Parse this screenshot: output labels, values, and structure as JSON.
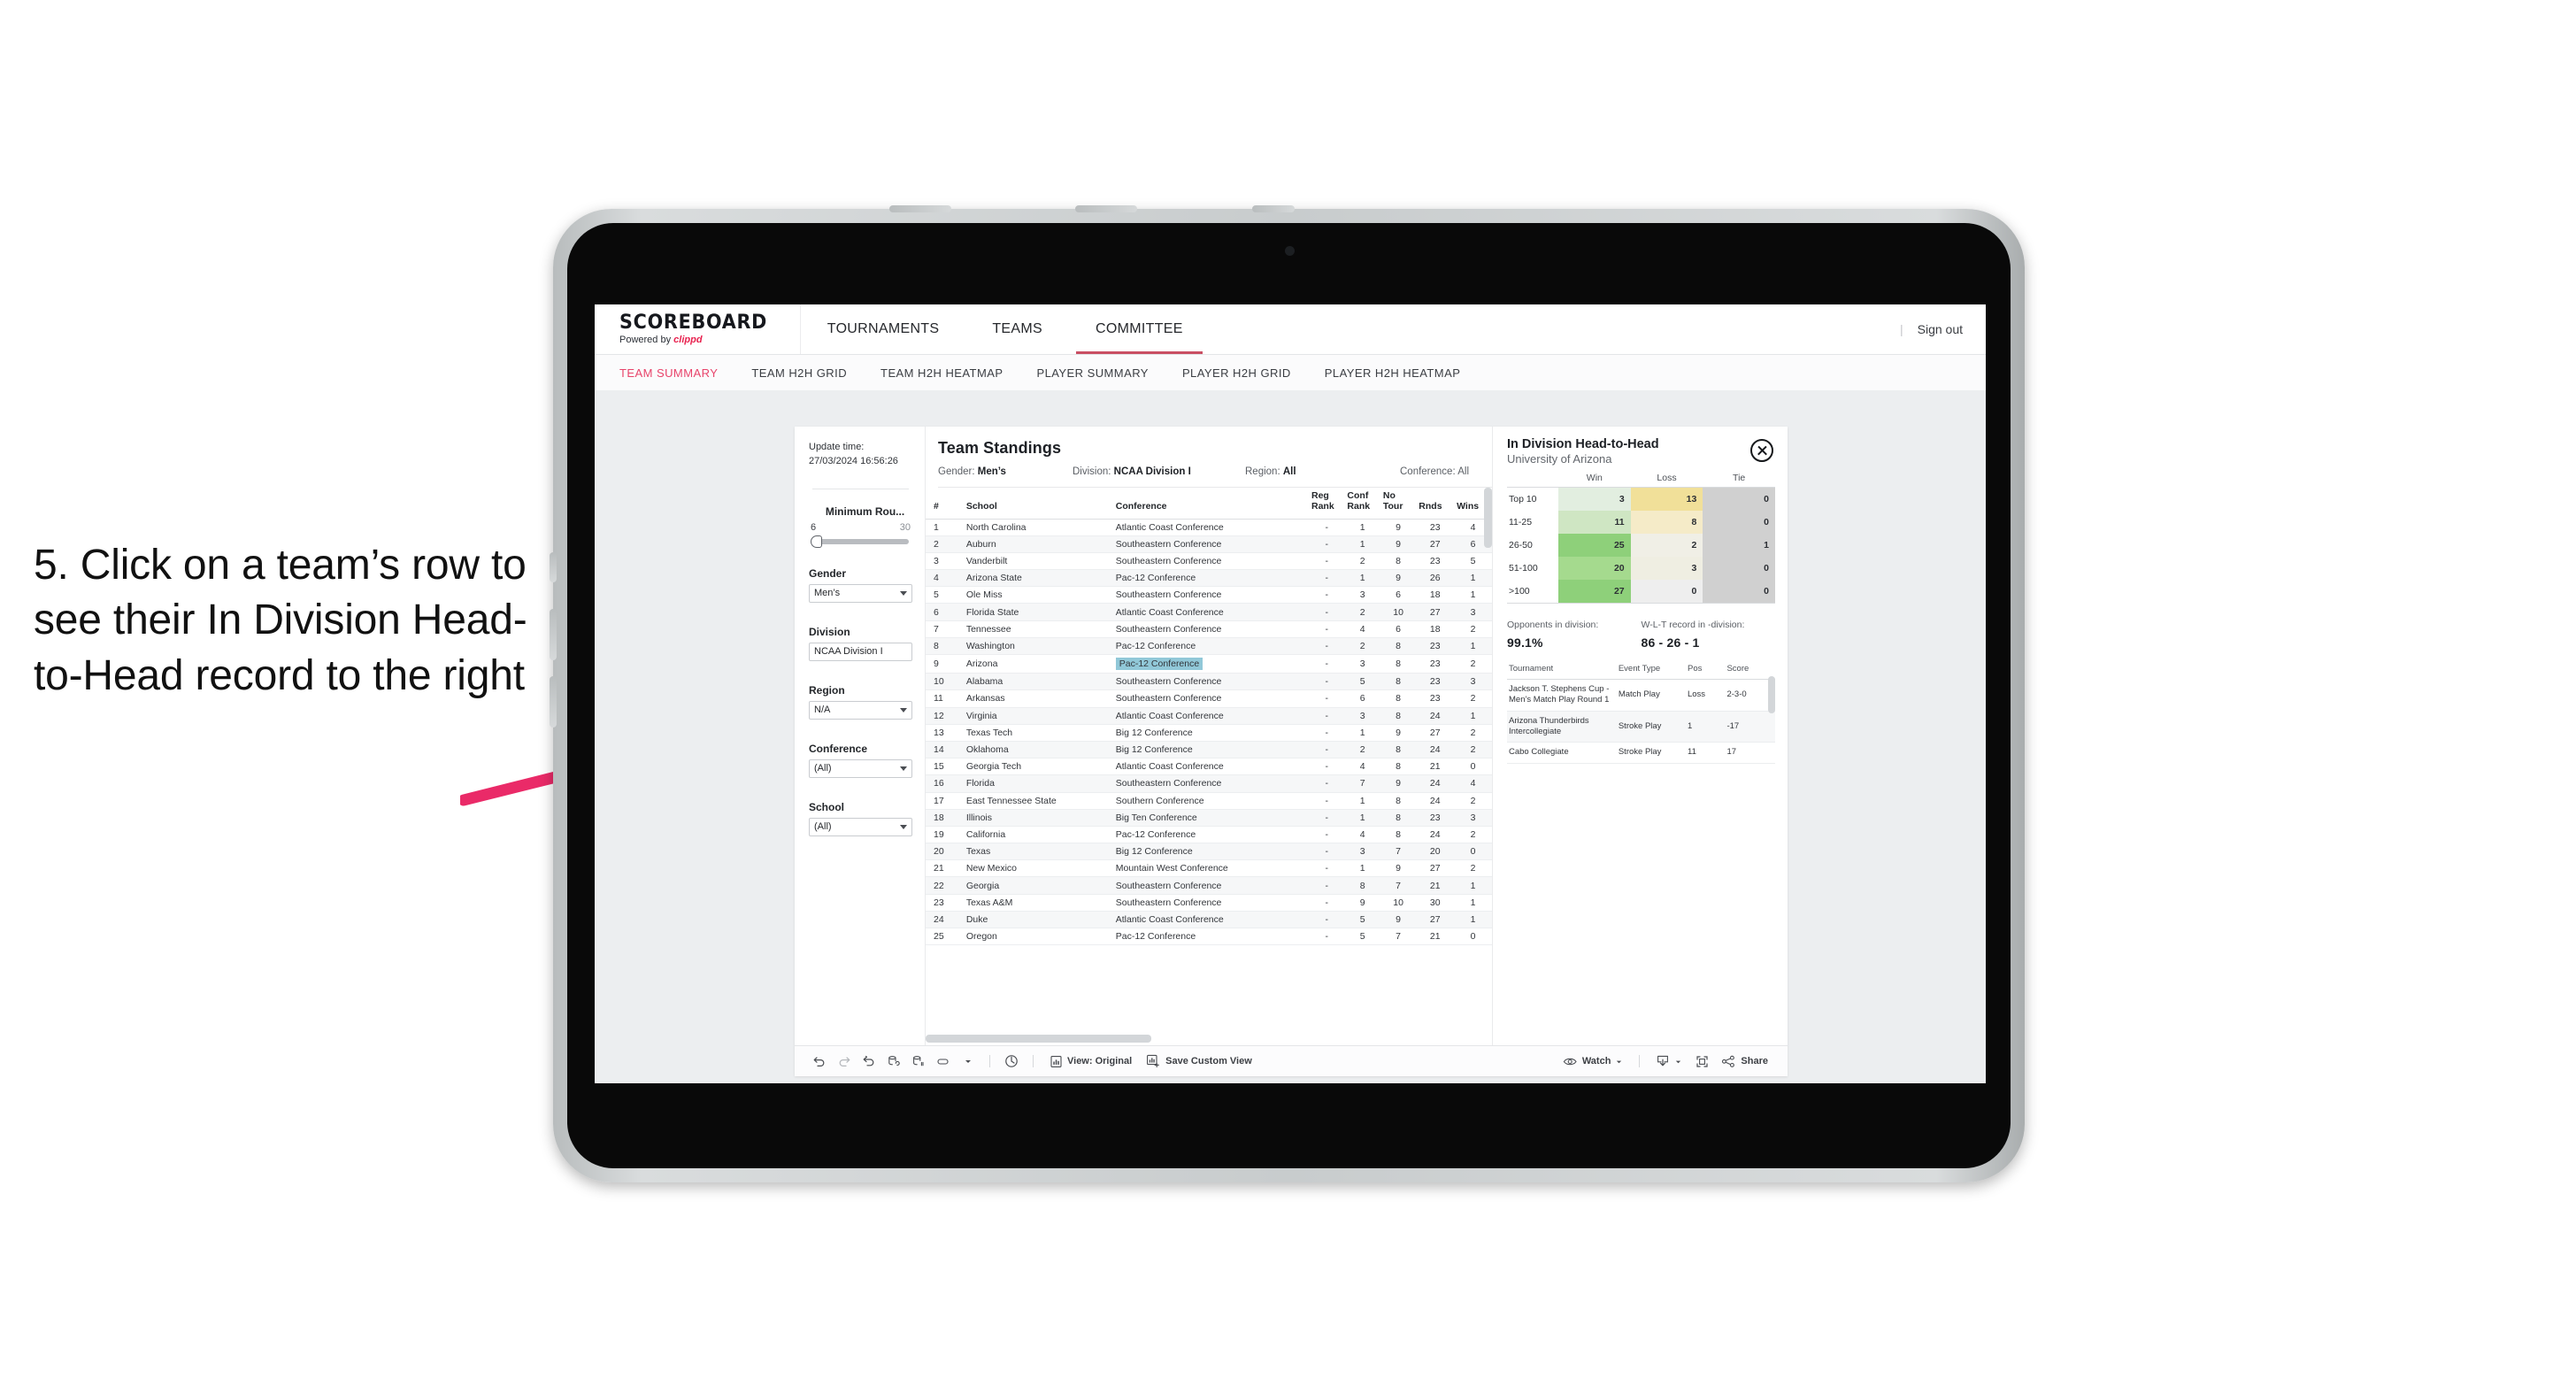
{
  "annotation": {
    "text": "5. Click on a team’s row to see their In Division Head-to-Head record to the right",
    "arrow_color": "#ea2a68"
  },
  "app": {
    "brand": {
      "name": "SCOREBOARD",
      "powered_prefix": "Powered by ",
      "powered_brand": "clippd"
    },
    "topnav": [
      {
        "label": "TOURNAMENTS",
        "active": false
      },
      {
        "label": "TEAMS",
        "active": false
      },
      {
        "label": "COMMITTEE",
        "active": true
      }
    ],
    "topbar_right": {
      "divider": "|",
      "sign_out": "Sign out"
    },
    "subnav": [
      {
        "label": "TEAM SUMMARY",
        "active": true
      },
      {
        "label": "TEAM H2H GRID",
        "active": false
      },
      {
        "label": "TEAM H2H HEATMAP",
        "active": false
      },
      {
        "label": "PLAYER SUMMARY",
        "active": false
      },
      {
        "label": "PLAYER H2H GRID",
        "active": false
      },
      {
        "label": "PLAYER H2H HEATMAP",
        "active": false
      }
    ]
  },
  "filters": {
    "update_label": "Update time:",
    "update_value": "27/03/2024 16:56:26",
    "min_rounds": {
      "title": "Minimum Rou...",
      "min": "6",
      "max": "30"
    },
    "gender": {
      "title": "Gender",
      "value": "Men’s"
    },
    "division": {
      "title": "Division",
      "value": "NCAA Division I"
    },
    "region": {
      "title": "Region",
      "value": "N/A"
    },
    "conference": {
      "title": "Conference",
      "value": "(All)"
    },
    "school": {
      "title": "School",
      "value": "(All)"
    }
  },
  "standings": {
    "title": "Team Standings",
    "meta": [
      {
        "label": "Gender: ",
        "value": "Men’s"
      },
      {
        "label": "Division: ",
        "value": "NCAA Division I"
      },
      {
        "label": "Region: ",
        "value": "All"
      },
      {
        "label": "Conference: ",
        "value": "All"
      }
    ],
    "columns": [
      "#",
      "School",
      "Conference",
      "Reg Rank",
      "Conf Rank",
      "No Tour",
      "Rnds",
      "Wins"
    ],
    "rows": [
      {
        "n": "1",
        "school": "North Carolina",
        "conf": "Atlantic Coast Conference",
        "reg": "-",
        "cr": "1",
        "nt": "9",
        "rn": "23",
        "wn": "4"
      },
      {
        "n": "2",
        "school": "Auburn",
        "conf": "Southeastern Conference",
        "reg": "-",
        "cr": "1",
        "nt": "9",
        "rn": "27",
        "wn": "6"
      },
      {
        "n": "3",
        "school": "Vanderbilt",
        "conf": "Southeastern Conference",
        "reg": "-",
        "cr": "2",
        "nt": "8",
        "rn": "23",
        "wn": "5"
      },
      {
        "n": "4",
        "school": "Arizona State",
        "conf": "Pac-12 Conference",
        "reg": "-",
        "cr": "1",
        "nt": "9",
        "rn": "26",
        "wn": "1"
      },
      {
        "n": "5",
        "school": "Ole Miss",
        "conf": "Southeastern Conference",
        "reg": "-",
        "cr": "3",
        "nt": "6",
        "rn": "18",
        "wn": "1"
      },
      {
        "n": "6",
        "school": "Florida State",
        "conf": "Atlantic Coast Conference",
        "reg": "-",
        "cr": "2",
        "nt": "10",
        "rn": "27",
        "wn": "3"
      },
      {
        "n": "7",
        "school": "Tennessee",
        "conf": "Southeastern Conference",
        "reg": "-",
        "cr": "4",
        "nt": "6",
        "rn": "18",
        "wn": "2"
      },
      {
        "n": "8",
        "school": "Washington",
        "conf": "Pac-12 Conference",
        "reg": "-",
        "cr": "2",
        "nt": "8",
        "rn": "23",
        "wn": "1"
      },
      {
        "n": "9",
        "school": "Arizona",
        "conf": "Pac-12 Conference",
        "reg": "-",
        "cr": "3",
        "nt": "8",
        "rn": "23",
        "wn": "2",
        "selected": true
      },
      {
        "n": "10",
        "school": "Alabama",
        "conf": "Southeastern Conference",
        "reg": "-",
        "cr": "5",
        "nt": "8",
        "rn": "23",
        "wn": "3"
      },
      {
        "n": "11",
        "school": "Arkansas",
        "conf": "Southeastern Conference",
        "reg": "-",
        "cr": "6",
        "nt": "8",
        "rn": "23",
        "wn": "2"
      },
      {
        "n": "12",
        "school": "Virginia",
        "conf": "Atlantic Coast Conference",
        "reg": "-",
        "cr": "3",
        "nt": "8",
        "rn": "24",
        "wn": "1"
      },
      {
        "n": "13",
        "school": "Texas Tech",
        "conf": "Big 12 Conference",
        "reg": "-",
        "cr": "1",
        "nt": "9",
        "rn": "27",
        "wn": "2"
      },
      {
        "n": "14",
        "school": "Oklahoma",
        "conf": "Big 12 Conference",
        "reg": "-",
        "cr": "2",
        "nt": "8",
        "rn": "24",
        "wn": "2"
      },
      {
        "n": "15",
        "school": "Georgia Tech",
        "conf": "Atlantic Coast Conference",
        "reg": "-",
        "cr": "4",
        "nt": "8",
        "rn": "21",
        "wn": "0"
      },
      {
        "n": "16",
        "school": "Florida",
        "conf": "Southeastern Conference",
        "reg": "-",
        "cr": "7",
        "nt": "9",
        "rn": "24",
        "wn": "4"
      },
      {
        "n": "17",
        "school": "East Tennessee State",
        "conf": "Southern Conference",
        "reg": "-",
        "cr": "1",
        "nt": "8",
        "rn": "24",
        "wn": "2"
      },
      {
        "n": "18",
        "school": "Illinois",
        "conf": "Big Ten Conference",
        "reg": "-",
        "cr": "1",
        "nt": "8",
        "rn": "23",
        "wn": "3"
      },
      {
        "n": "19",
        "school": "California",
        "conf": "Pac-12 Conference",
        "reg": "-",
        "cr": "4",
        "nt": "8",
        "rn": "24",
        "wn": "2"
      },
      {
        "n": "20",
        "school": "Texas",
        "conf": "Big 12 Conference",
        "reg": "-",
        "cr": "3",
        "nt": "7",
        "rn": "20",
        "wn": "0"
      },
      {
        "n": "21",
        "school": "New Mexico",
        "conf": "Mountain West Conference",
        "reg": "-",
        "cr": "1",
        "nt": "9",
        "rn": "27",
        "wn": "2"
      },
      {
        "n": "22",
        "school": "Georgia",
        "conf": "Southeastern Conference",
        "reg": "-",
        "cr": "8",
        "nt": "7",
        "rn": "21",
        "wn": "1"
      },
      {
        "n": "23",
        "school": "Texas A&M",
        "conf": "Southeastern Conference",
        "reg": "-",
        "cr": "9",
        "nt": "10",
        "rn": "30",
        "wn": "1"
      },
      {
        "n": "24",
        "school": "Duke",
        "conf": "Atlantic Coast Conference",
        "reg": "-",
        "cr": "5",
        "nt": "9",
        "rn": "27",
        "wn": "1"
      },
      {
        "n": "25",
        "school": "Oregon",
        "conf": "Pac-12 Conference",
        "reg": "-",
        "cr": "5",
        "nt": "7",
        "rn": "21",
        "wn": "0"
      }
    ]
  },
  "h2h": {
    "title": "In Division Head-to-Head",
    "subtitle": "University of Arizona",
    "close_icon": "close-circle-icon",
    "columns": [
      "",
      "Win",
      "Loss",
      "Tie"
    ],
    "rows": [
      {
        "band": "Top 10",
        "win": "3",
        "loss": "13",
        "tie": "0",
        "win_color": "#e2eee0",
        "loss_color": "#f1e099",
        "tie_color": "#d0d0d0"
      },
      {
        "band": "11-25",
        "win": "11",
        "loss": "8",
        "tie": "0",
        "win_color": "#cfe6c3",
        "loss_color": "#f5ebc8",
        "tie_color": "#d0d0d0"
      },
      {
        "band": "26-50",
        "win": "25",
        "loss": "2",
        "tie": "1",
        "win_color": "#8ed07a",
        "loss_color": "#f0efe6",
        "tie_color": "#d0d0d0"
      },
      {
        "band": "51-100",
        "win": "20",
        "loss": "3",
        "tie": "0",
        "win_color": "#a5da8e",
        "loss_color": "#efeee2",
        "tie_color": "#d0d0d0"
      },
      {
        "band": ">100",
        "win": "27",
        "loss": "0",
        "tie": "0",
        "win_color": "#8ed07a",
        "loss_color": "#eeeeee",
        "tie_color": "#d0d0d0"
      }
    ],
    "stats": [
      {
        "label": "Opponents in division:",
        "value": "99.1%"
      },
      {
        "label": "W-L-T record in -division:",
        "value": "86 - 26 - 1"
      }
    ],
    "events_columns": [
      "Tournament",
      "Event Type",
      "Pos",
      "Score"
    ],
    "events": [
      {
        "tournament": "Jackson T. Stephens Cup - Men’s Match Play Round 1",
        "type": "Match Play",
        "pos": "Loss",
        "score": "2-3-0"
      },
      {
        "tournament": "Arizona Thunderbirds Intercollegiate",
        "type": "Stroke Play",
        "pos": "1",
        "score": "-17"
      },
      {
        "tournament": "Cabo Collegiate",
        "type": "Stroke Play",
        "pos": "11",
        "score": "17"
      }
    ]
  },
  "toolbar": {
    "icons": [
      "undo-icon",
      "redo-icon",
      "revert-icon",
      "refresh-data-icon",
      "pause-updates-icon",
      "shape-icon",
      "chevron-down-icon"
    ],
    "divider": "|",
    "view_label": "View: Original",
    "save_label": "Save Custom View",
    "watch_label": "Watch",
    "share_label": "Share",
    "download_icon": "download-icon",
    "fullscreen_icon": "fullscreen-icon",
    "eye_icon": "eye-icon",
    "share_icon": "share-nodes-icon"
  }
}
